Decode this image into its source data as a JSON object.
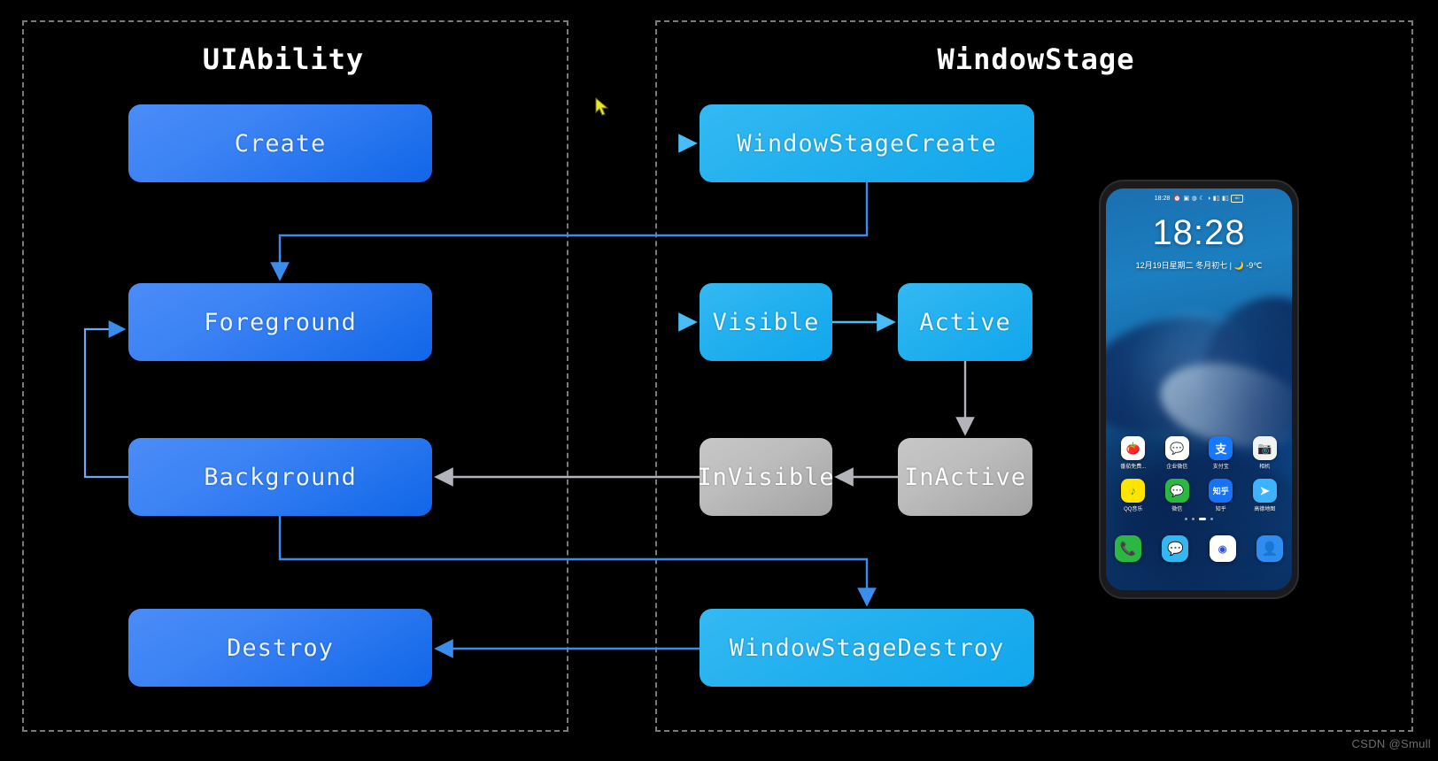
{
  "columns": {
    "left_title": "UIAbility",
    "right_title": "WindowStage"
  },
  "nodes": {
    "create": "Create",
    "foreground": "Foreground",
    "background": "Background",
    "destroy": "Destroy",
    "windowstagecreate": "WindowStageCreate",
    "visible": "Visible",
    "active": "Active",
    "invisible": "InVisible",
    "inactive": "InActive",
    "windowstagedestroy": "WindowStageDestroy"
  },
  "colors": {
    "blue_node": "#2f7df2",
    "cyan_node": "#22b0ef",
    "gray_node": "#b6b6b6",
    "arrow_blue": "#2f7df2",
    "arrow_cyan": "#3fb8f5",
    "arrow_gray": "#b0b0b8",
    "frame_dash": "#7a7a7a",
    "background": "#000000"
  },
  "phone": {
    "status_time": "18:28",
    "status_icons": [
      "alarm-icon",
      "screenshot-icon",
      "wifi-dot-icon",
      "moon-icon",
      "clock-icon",
      "signal-icon",
      "signal-icon"
    ],
    "battery_level": "60",
    "clock": "18:28",
    "date_weather": "12月19日星期二  冬月初七  |  🌙 -9℃",
    "apps": [
      {
        "label": "番茄免费...",
        "icon": "tomato-icon",
        "glyph": "🍅",
        "bg": "#ffffff",
        "fg": "#e8452c"
      },
      {
        "label": "企业微信",
        "icon": "wecom-icon",
        "glyph": "💬",
        "bg": "#ffffff",
        "fg": "#2d8cf0"
      },
      {
        "label": "支付宝",
        "icon": "alipay-icon",
        "glyph": "支",
        "bg": "#1677ff",
        "fg": "#ffffff"
      },
      {
        "label": "相机",
        "icon": "camera-icon",
        "glyph": "📷",
        "bg": "#f2f2f2",
        "fg": "#333333"
      },
      {
        "label": "QQ音乐",
        "icon": "qqmusic-icon",
        "glyph": "♪",
        "bg": "#ffe400",
        "fg": "#16a34a"
      },
      {
        "label": "微信",
        "icon": "wechat-icon",
        "glyph": "💬",
        "bg": "#2bb741",
        "fg": "#ffffff"
      },
      {
        "label": "知乎",
        "icon": "zhihu-icon",
        "glyph": "知乎",
        "bg": "#1772f6",
        "fg": "#ffffff"
      },
      {
        "label": "高德地图",
        "icon": "amap-icon",
        "glyph": "➤",
        "bg": "#3db3ff",
        "fg": "#ffffff"
      }
    ],
    "page_dots": 4,
    "page_dot_active": 2,
    "dock": [
      {
        "label": "phone",
        "icon": "phone-icon",
        "glyph": "📞",
        "bg": "#2bb741"
      },
      {
        "label": "messages",
        "icon": "message-icon",
        "glyph": "💬",
        "bg": "#34b7f1"
      },
      {
        "label": "browser",
        "icon": "browser-icon",
        "glyph": "◉",
        "bg": "#ffffff"
      },
      {
        "label": "contacts",
        "icon": "contacts-icon",
        "glyph": "👤",
        "bg": "#2f8cf0"
      }
    ]
  },
  "watermark": "CSDN @Smull",
  "chart_data": {
    "type": "diagram",
    "title": "UIAbility and WindowStage lifecycle state diagram",
    "groups": [
      {
        "name": "UIAbility",
        "states": [
          "Create",
          "Foreground",
          "Background",
          "Destroy"
        ]
      },
      {
        "name": "WindowStage",
        "states": [
          "WindowStageCreate",
          "Visible",
          "Active",
          "InVisible",
          "InActive",
          "WindowStageDestroy"
        ]
      }
    ],
    "edges": [
      {
        "from": "Create",
        "to": "WindowStageCreate",
        "color": "blue"
      },
      {
        "from": "WindowStageCreate",
        "to": "Foreground",
        "color": "blue"
      },
      {
        "from": "Foreground",
        "to": "Visible",
        "color": "blue"
      },
      {
        "from": "Visible",
        "to": "Active",
        "color": "blue"
      },
      {
        "from": "Active",
        "to": "InActive",
        "color": "gray"
      },
      {
        "from": "InActive",
        "to": "InVisible",
        "color": "gray"
      },
      {
        "from": "InVisible",
        "to": "Background",
        "color": "gray"
      },
      {
        "from": "Background",
        "to": "Foreground",
        "color": "blue"
      },
      {
        "from": "Background",
        "to": "WindowStageDestroy",
        "color": "blue"
      },
      {
        "from": "WindowStageDestroy",
        "to": "Destroy",
        "color": "blue"
      }
    ]
  }
}
